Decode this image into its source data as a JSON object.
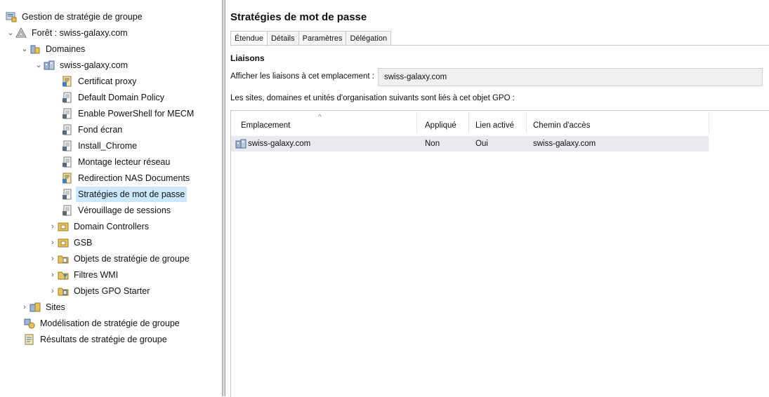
{
  "tree": {
    "root": "Gestion de stratégie de groupe",
    "forest": "Forêt : swiss-galaxy.com",
    "domains": "Domaines",
    "domain": "swiss-galaxy.com",
    "gpos": [
      "Certificat proxy",
      "Default Domain Policy",
      "Enable PowerShell for MECM",
      "Fond écran",
      "Install_Chrome",
      "Montage lecteur réseau",
      "Redirection NAS Documents",
      "Stratégies de mot de passe",
      "Vérouillage de sessions"
    ],
    "containers": [
      "Domain Controllers",
      "GSB",
      "Objets de stratégie de groupe",
      "Filtres WMI",
      "Objets GPO Starter"
    ],
    "sites": "Sites",
    "modeling": "Modélisation de stratégie de groupe",
    "results": "Résultats de stratégie de groupe",
    "selected": "Stratégies de mot de passe"
  },
  "right": {
    "title": "Stratégies de mot de passe",
    "tabs": [
      "Étendue",
      "Détails",
      "Paramètres",
      "Délégation"
    ],
    "active_tab": "Étendue",
    "section": "Liaisons",
    "show_links_label": "Afficher les liaisons à cet emplacement :",
    "show_links_value": "swiss-galaxy.com",
    "description": "Les sites, domaines et unités d'organisation suivants sont liés à cet objet GPO :",
    "columns": [
      "Emplacement",
      "Appliqué",
      "Lien activé",
      "Chemin d'accès"
    ],
    "rows": [
      {
        "location": "swiss-galaxy.com",
        "enforced": "Non",
        "enabled": "Oui",
        "path": "swiss-galaxy.com"
      }
    ]
  },
  "colors": {
    "selection": "#cce8ff",
    "row_highlight": "#e8eaee",
    "field_bg": "#f0f0f0"
  }
}
